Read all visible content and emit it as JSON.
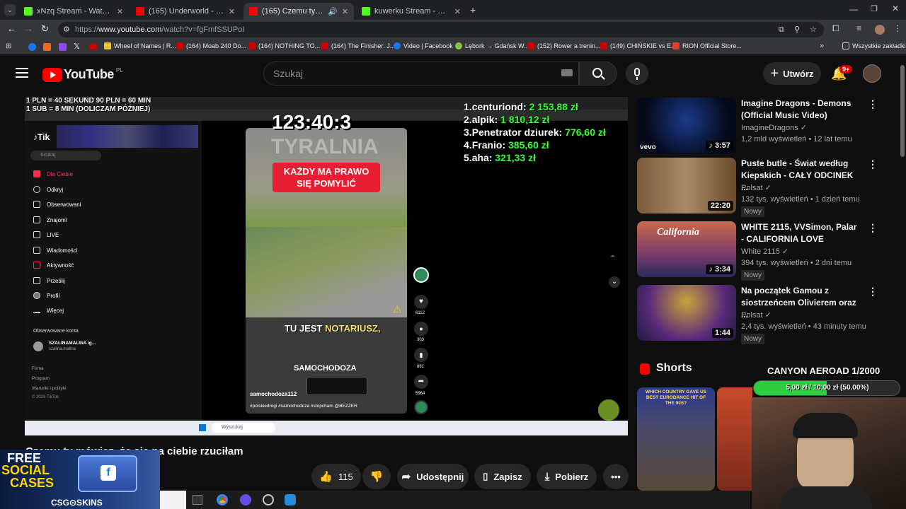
{
  "tabs": [
    {
      "title": "xNzq Stream - Watch Live on K",
      "color": "#53fc18"
    },
    {
      "title": "(165) Underworld - Born slippy",
      "color": "#ff0000"
    },
    {
      "title": "(165) Czemu ty mówisz, że",
      "color": "#ff0000"
    },
    {
      "title": "kuwerku Stream - Watch Live o",
      "color": "#53fc18"
    }
  ],
  "url_prefix": "https://",
  "url_domain": "www.youtube.com",
  "url_path": "/watch?v=fgFmfSSUPoI",
  "bookmarks": [
    "Wheel of Names | R...",
    "(164) Moab 240 Do...",
    "(164) NOTHING TO...",
    "(164) The Finisher: J...",
    "Video | Facebook",
    "Lębork → Gdańsk W...",
    "(152) Rower a trenin...",
    "(149) CHIŃSKIE vs E...",
    "RION Official Store..."
  ],
  "bookmarks_folder": "Wszystkie zakładki",
  "yt": {
    "logo": "YouTube",
    "region": "PL",
    "search_placeholder": "Szukaj",
    "create_label": "Utwórz",
    "notif_count": "9+"
  },
  "overlay": {
    "rules_line1": "1 PLN = 40 SEKUND 90 PLN = 60 MIN",
    "rules_line2": "1 SUB = 8 MIN (DOLICZAM PÓŹNIEJ)",
    "timer": "123:40:3",
    "leaderboard": [
      {
        "rank": "1.",
        "name": "centuriond:",
        "value": "2 153,88 zł"
      },
      {
        "rank": "2.",
        "name": "alpik:",
        "value": "1 810,12 zł"
      },
      {
        "rank": "3.",
        "name": "Penetrator dziurek:",
        "value": "776,60 zł"
      },
      {
        "rank": "4.",
        "name": "Franio:",
        "value": "385,60 zł"
      },
      {
        "rank": "5.",
        "name": "aha:",
        "value": "321,33 zł"
      }
    ],
    "goal_title": "CANYON AEROAD 1/2000",
    "goal_progress": "5,00 zł / 10,00 zł (50.00%)",
    "goal_fraction": 0.5,
    "promo_line1": "FREE",
    "promo_line2": "SOCIAL",
    "promo_line3": "CASES",
    "promo_brand": "CSG⊙SKINS"
  },
  "tiktok": {
    "menu": [
      "Dla Ciebie",
      "Odkryj",
      "Obserwowani",
      "Znajomi",
      "LIVE",
      "Wiadomości",
      "Aktywność",
      "Prześlij",
      "Profil",
      "Więcej"
    ],
    "following_label": "Obserwowane konta",
    "account_name": "SZALINAMALINA ig...",
    "account_handle": "szalina.malina",
    "footer": [
      "Firma",
      "Program",
      "Warunki i polityki",
      "© 2026 TikTok"
    ],
    "search": "Szukaj",
    "video_banner_1": "KAŻDY MA PRAWO",
    "video_banner_2": "SIĘ POMYLIĆ",
    "watermark": "TYRALNIA",
    "caption_1": "TU JEST",
    "caption_2": "NOTARIUSZ,",
    "caption_3": "SAMOCHODOZA",
    "author": "samochodoza112",
    "hashtags": "#polskiedrogi #samochodoza #stopcham @BEZZER",
    "likes": "6112",
    "comments": "303",
    "saves": "861",
    "shares": "5964",
    "taskbar_search": "Wyszukaj"
  },
  "video_title": "Czemu ty mówisz, że się na ciebie rzuciłam",
  "actions": {
    "likes": "115",
    "share": "Udostępnij",
    "save": "Zapisz",
    "download": "Pobierz"
  },
  "recommendations": [
    {
      "title": "Imagine Dragons - Demons (Official Music Video)",
      "channel": "ImagineDragons",
      "meta": "1,2 mld wyświetleń • 12 lat temu",
      "duration": "3:57",
      "badge": "",
      "thumb_label": "vevo"
    },
    {
      "title": "Puste butle - Świat według Kiepskich - CAŁY ODCINEK ...",
      "channel": "Polsat",
      "meta": "132 tys. wyświetleń • 1 dzień temu",
      "duration": "22:20",
      "badge": "Nowy",
      "thumb_label": ""
    },
    {
      "title": "WHITE 2115, VVSimon, Palar - CALIFORNIA LOVE",
      "channel": "White 2115",
      "meta": "394 tys. wyświetleń • 2 dni temu",
      "duration": "3:34",
      "badge": "Nowy",
      "thumb_label": "California"
    },
    {
      "title": "Na początek Gamou z siostrzeńcem Olivierem oraz ...",
      "channel": "Polsat",
      "meta": "2,4 tys. wyświetleń • 43 minuty temu",
      "duration": "1:44",
      "badge": "Nowy",
      "thumb_label": ""
    }
  ],
  "shorts_label": "Shorts",
  "short_caption": "WHICH COUNTRY GAVE US BEST EURODANCE HIT OF THE 90S?"
}
